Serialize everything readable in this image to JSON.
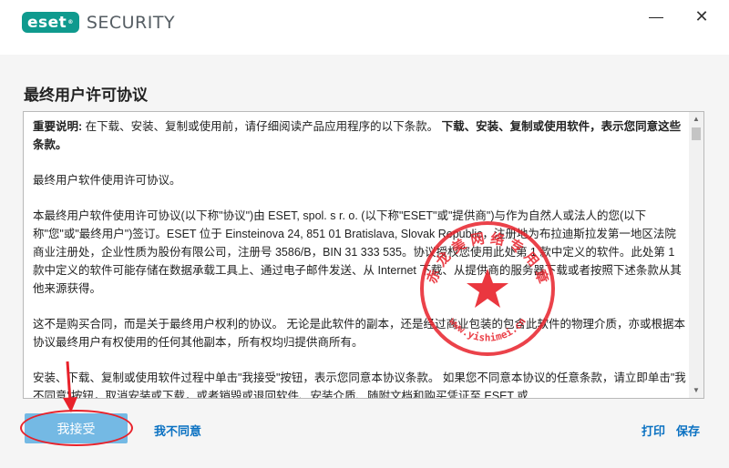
{
  "app": {
    "logo_badge": "eset",
    "logo_text": "SECURITY"
  },
  "window": {
    "minimize_glyph": "—",
    "close_glyph": "✕"
  },
  "page": {
    "heading": "最终用户许可协议"
  },
  "eula": {
    "p1_bold": "重要说明:",
    "p1_text": " 在下载、安装、复制或使用前，请仔细阅读产品应用程序的以下条款。",
    "p1_bold2": " 下载、安装、复制或使用软件，表示您同意这些条款。",
    "p2": "最终用户软件使用许可协议。",
    "p3": "本最终用户软件使用许可协议(以下称\"协议\")由 ESET, spol. s r. o. (以下称\"ESET\"或\"提供商\")与作为自然人或法人的您(以下称\"您\"或\"最终用户\")签订。ESET 位于 Einsteinova 24, 851 01 Bratislava, Slovak Republic，注册地为布拉迪斯拉发第一地区法院商业注册处，企业性质为股份有限公司，注册号 3586/B，BIN 31 333 535。协议授权您使用此处第 1 款中定义的软件。此处第 1 款中定义的软件可能存储在数据承载工具上、通过电子邮件发送、从 Internet 下载、从提供商的服务器下载或者按照下述条款从其他来源获得。",
    "p4": "这不是购买合同，而是关于最终用户权利的协议。 无论是此软件的副本，还是经过商业包装的包含此软件的物理介质，亦或根据本协议最终用户有权使用的任何其他副本，所有权均归提供商所有。",
    "p5": "安装、下载、复制或使用软件过程中单击\"我接受\"按钮，表示您同意本协议条款。 如果您不同意本协议的任意条款，请立即单击\"我不同意\"按钮，取消安装或下载，或者销毁或退回软件、安装介质、随附文档和购买凭证至 ESET 或"
  },
  "scrollbar": {
    "up_glyph": "▲",
    "down_glyph": "▼"
  },
  "buttons": {
    "accept": "我接受",
    "decline": "我不同意",
    "print": "打印",
    "save": "保存"
  },
  "watermark": {
    "text_top": "赤 龙 美 网 络 专 用 章",
    "text_bottom": "www.yishimei.cn"
  },
  "colors": {
    "brand": "#0f9a8e",
    "link": "#0a71c2",
    "accept_bg": "#74b9e4",
    "annotation_red": "#e8212a"
  }
}
